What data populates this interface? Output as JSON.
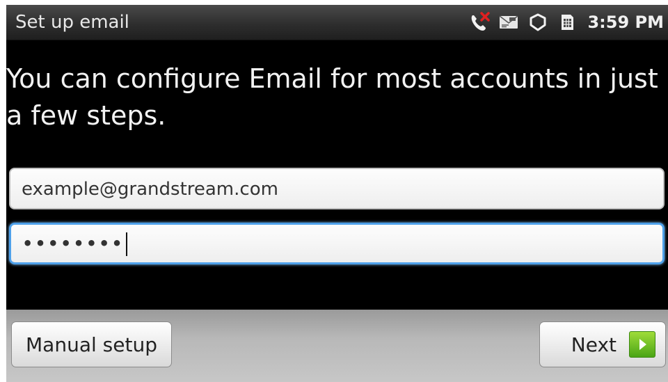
{
  "status_bar": {
    "title": "Set up email",
    "time": "3:59 PM",
    "icons": [
      "missed-call-icon",
      "voicemail-icon",
      "sync-icon",
      "sim-card-icon"
    ]
  },
  "intro_text": "You can configure Email for most accounts in just a few steps.",
  "form": {
    "email_value": "example@grandstream.com",
    "password_masked": "••••••••"
  },
  "buttons": {
    "manual_setup": "Manual setup",
    "next": "Next"
  },
  "colors": {
    "focus_border": "#4fa1ea",
    "next_arrow": "#6cc323",
    "missed_call_x": "#e02020"
  }
}
